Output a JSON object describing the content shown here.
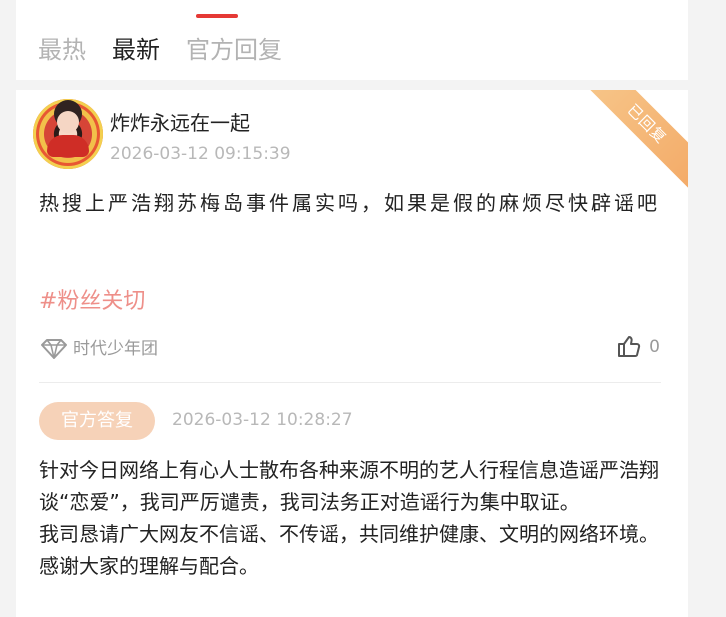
{
  "tabs": {
    "hot": "最热",
    "new": "最新",
    "official": "官方回复",
    "active": "new",
    "accent_color": "#e53935"
  },
  "post": {
    "status_ribbon": "已回复",
    "username": "炸炸永远在一起",
    "time": "2026-03-12 09:15:39",
    "body": "热搜上严浩翔苏梅岛事件属实吗，如果是假的麻烦尽快辟谣吧",
    "tag": "#粉丝关切",
    "group_icon": "diamond-icon",
    "group_name": "时代少年团",
    "like_icon": "thumbs-up-icon",
    "like_count": "0"
  },
  "official_reply": {
    "badge": "官方答复",
    "time": "2026-03-12 10:28:27",
    "paragraphs": [
      "针对今日网络上有心人士散布各种来源不明的艺人行程信息造谣严浩翔谈“恋爱”，我司严厉谴责，我司法务正对造谣行为集中取证。",
      "我司恳请广大网友不信谣、不传谣，共同维护健康、文明的网络环境。感谢大家的理解与配合。"
    ]
  },
  "colors": {
    "tag_color": "#ee8f89",
    "ribbon_color": "#f3a966",
    "badge_color": "#f6d2b8"
  }
}
